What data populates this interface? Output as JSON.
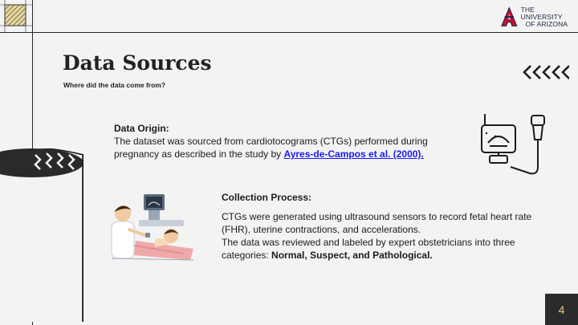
{
  "logo": {
    "line1": "THE UNIVERSITY",
    "line2": "OF ARIZONA"
  },
  "slide": {
    "title": "Data Sources",
    "subtitle": "Where did the data come from?",
    "page_number": "4"
  },
  "data_origin": {
    "heading": "Data Origin:",
    "text_1": "The dataset was sourced from cardiotocograms (CTGs) performed during pregnancy as described in the study by ",
    "citation": "Ayres-de-Campos et al. (2000)."
  },
  "collection_process": {
    "heading": "Collection Process:",
    "paragraph_1": "CTGs were generated using ultrasound sensors to record fetal heart rate (FHR), uterine contractions, and accelerations.",
    "paragraph_2_prefix": "The data was reviewed and labeled by expert obstetricians into three categories: ",
    "paragraph_2_bold": "Normal, Suspect, and Pathological."
  },
  "colors": {
    "background": "#f3f3f3",
    "link": "#1a1aff",
    "page_box": "#2b2b2b",
    "page_number": "#e7cf7a",
    "logo_red": "#c8102e",
    "logo_navy": "#1f2a44"
  },
  "icons": [
    "pattern-tile",
    "university-logo",
    "chevron-left-icon",
    "drum-decoration",
    "ultrasound-monitor-icon",
    "doctor-patient-illustration"
  ]
}
